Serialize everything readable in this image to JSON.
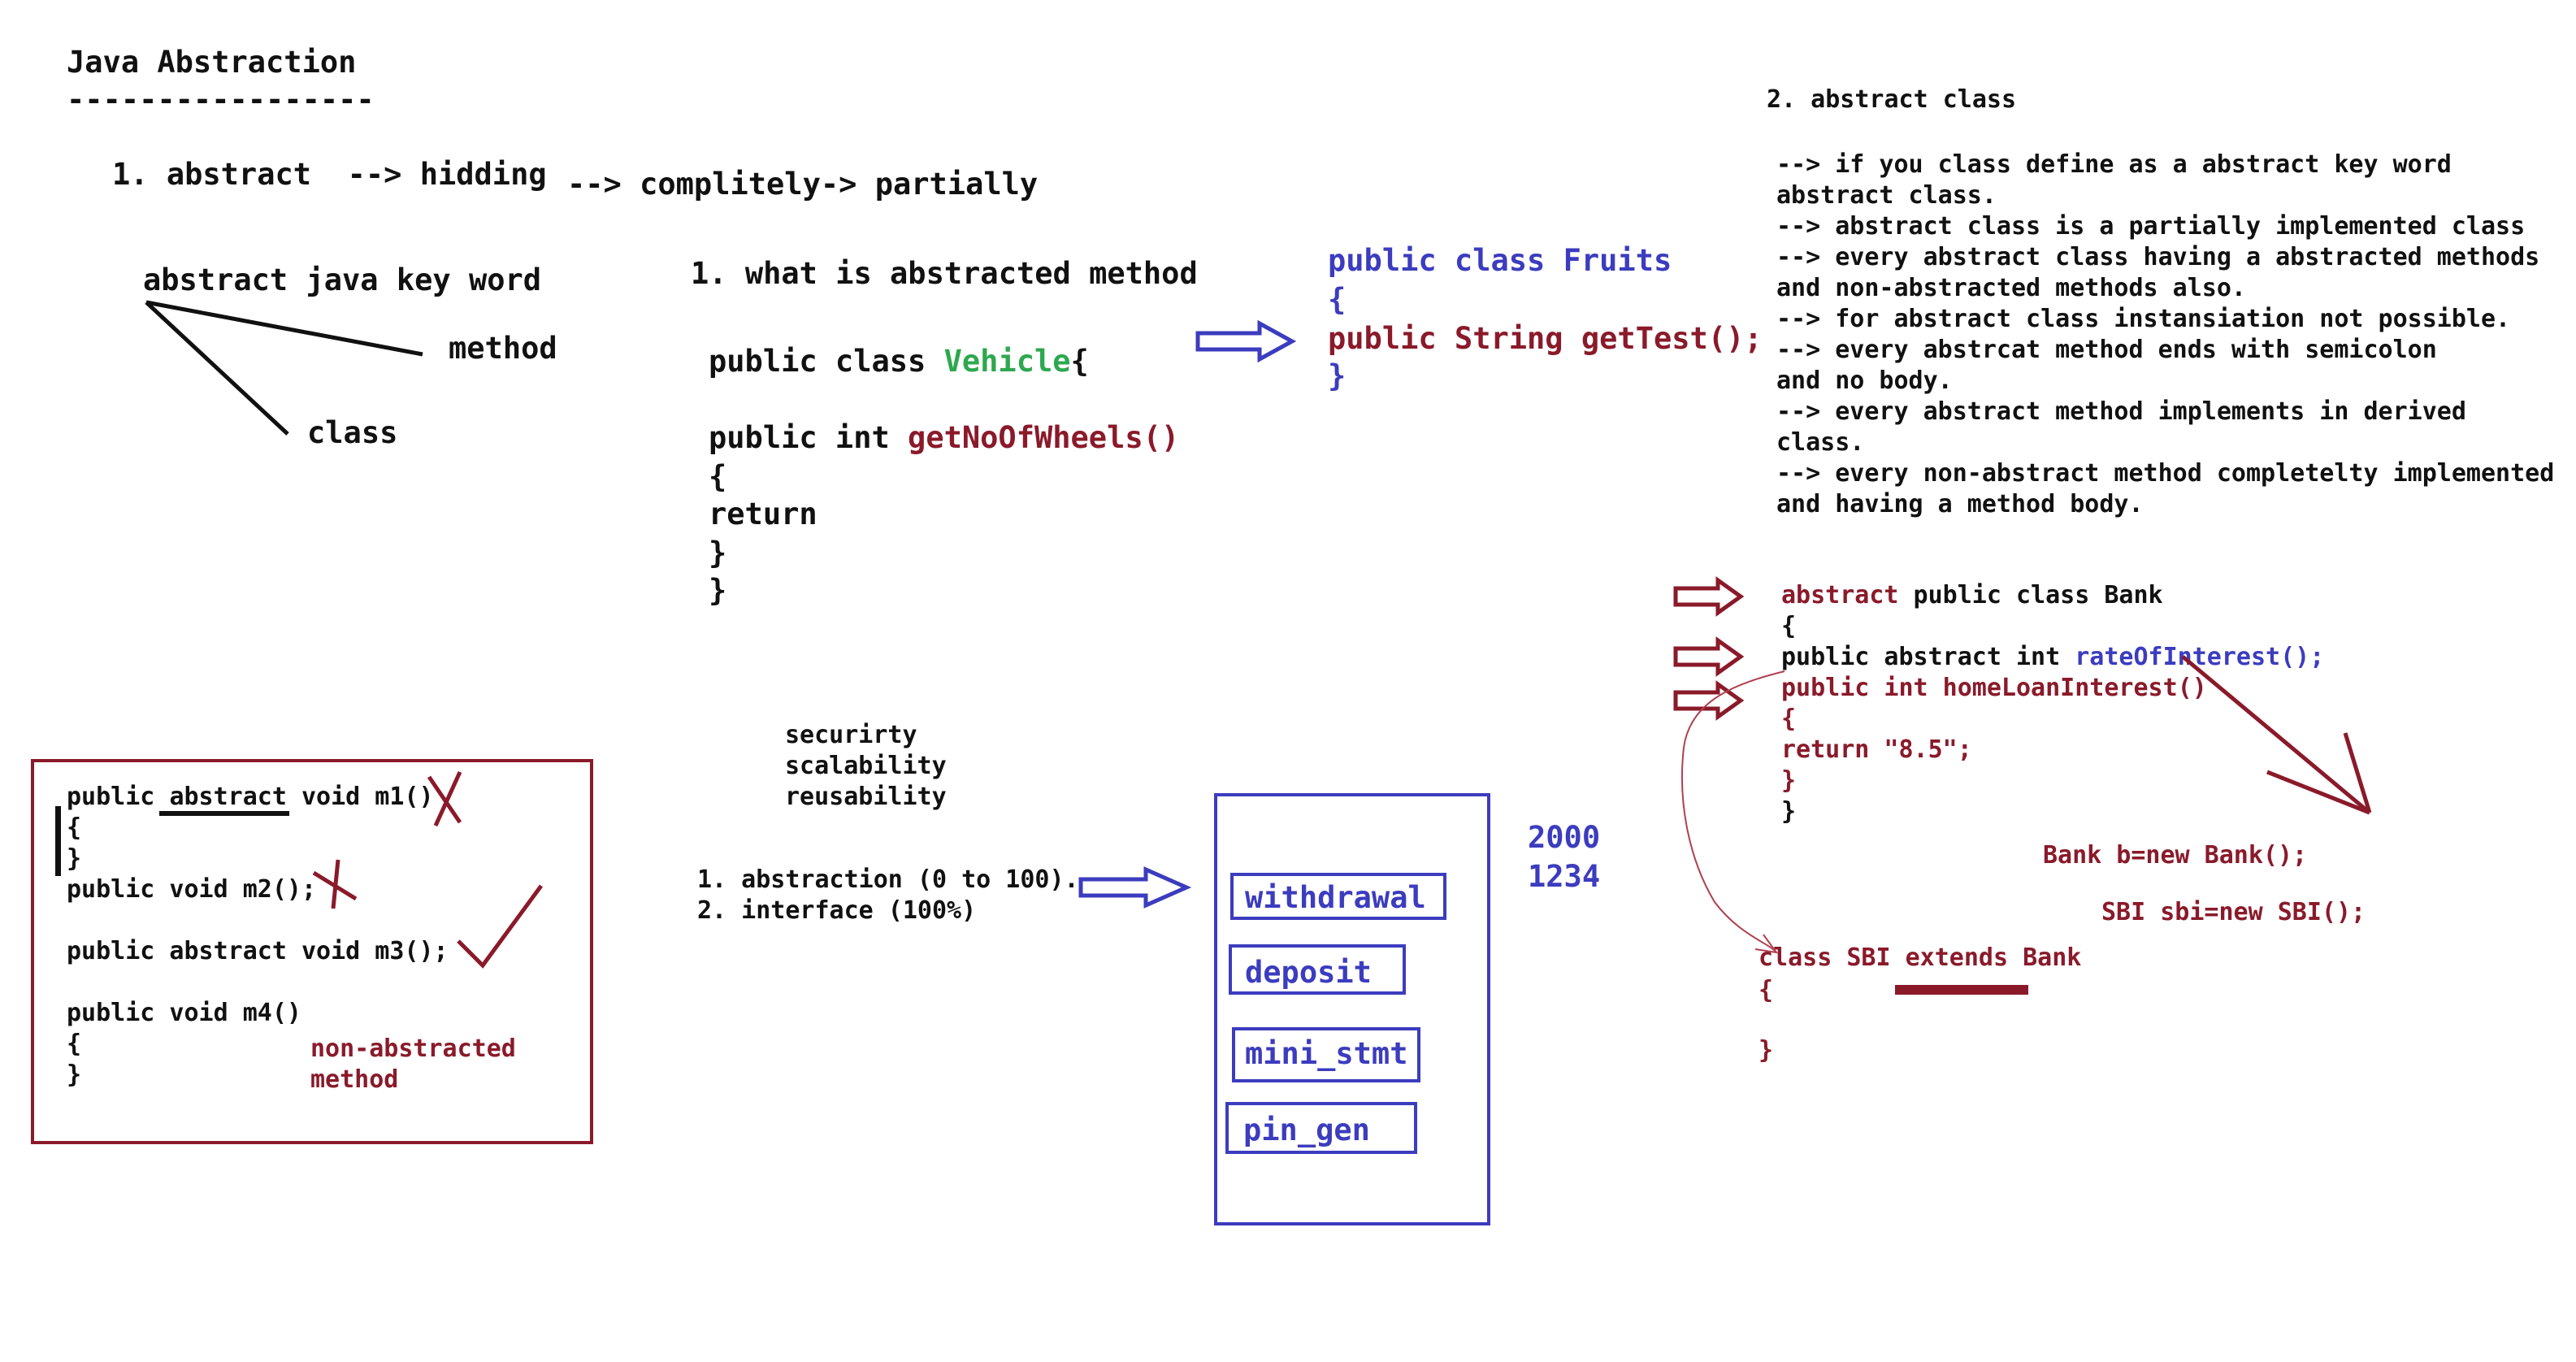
{
  "title": "Java Abstraction",
  "title_underline": "-----------------",
  "intro": {
    "line1": "1. abstract  --> hidding",
    "line2": "--> complitely-> partially",
    "keyword": "abstract java key word",
    "method": "method",
    "class": "class"
  },
  "method_section": {
    "heading": "1. what is abstracted method",
    "line_public_class": "public class ",
    "class_name": "Vehicle",
    "brace_open_inline": "{",
    "line_public_int": "public int ",
    "method_name": "getNoOfWheels()",
    "brace_open": "{",
    "return": "return",
    "brace_close1": "}",
    "brace_close2": "}"
  },
  "fruits": {
    "line1": "public class Fruits",
    "line2": "{",
    "line3": "public String getTest();",
    "line4": "}"
  },
  "abstract_class_notes": {
    "heading": "2. abstract class",
    "lines": [
      "--> if you class define as a abstract key word",
      "abstract class.",
      "--> abstract class is a partially implemented class",
      "--> every abstract class having a abstracted methods",
      "and non-abstracted methods also.",
      "--> for abstract class instansiation not possible.",
      "--> every abstrcat method ends with semicolon",
      "and no body.",
      "--> every abstract method implements in derived",
      "class.",
      "--> every non-abstract method completelty implemented",
      "and having a method body."
    ]
  },
  "bank": {
    "line1_kw": "abstract",
    "line1_rest": " public class Bank",
    "line2": "{",
    "line3_prefix": "public abstract int ",
    "line3_method": "rateOfInterest();",
    "line4": "public int homeLoanInterest()",
    "line5": "{",
    "line6": "return \"8.5\";",
    "line7": "}",
    "line8": "}",
    "instance1": "Bank b=new Bank();",
    "instance2": "SBI sbi=new SBI();",
    "sbi_line1": "class SBI extends Bank",
    "sbi_line2": "{",
    "sbi_line3": "}"
  },
  "left_box": {
    "m1_pre": "public ",
    "m1_kw": "abstract",
    "m1_post": " void m1()",
    "brace_open": "{",
    "brace_close": "}",
    "m2": "public void m2();",
    "m3": "public abstract void m3();",
    "m4": "public void m4()",
    "m4_open": "{",
    "m4_close": "}",
    "note1": "non-abstracted",
    "note2": "method"
  },
  "benefits": [
    "securirty",
    "scalability",
    "reusability"
  ],
  "types": [
    "1. abstraction (0 to 100).",
    "2. interface (100%)"
  ],
  "atm": {
    "buttons": [
      "withdrawal",
      "deposit",
      "mini_stmt",
      "pin_gen"
    ],
    "numbers": [
      "2000",
      "1234"
    ]
  },
  "colors": {
    "blue": "#3c3cbf",
    "maroon": "#8a1a2a",
    "green": "#2ea84f",
    "black": "#111111"
  }
}
